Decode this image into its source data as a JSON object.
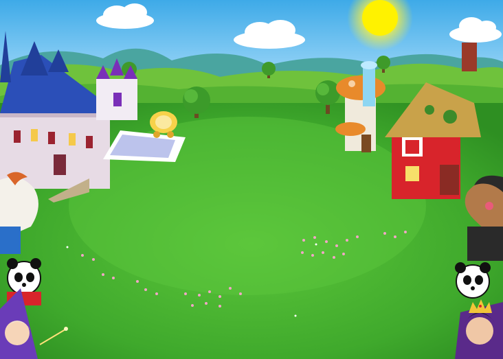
{
  "scene": {
    "colors": {
      "sky_top": "#4fb6f0",
      "sky_bottom": "#bfe8ff",
      "sun": "#fff23a",
      "meadow": "#3da42b",
      "meadow_light": "#58c23a",
      "hills_far": "#4aa5a0",
      "hills_mid": "#6cc03a",
      "castle_roof": "#2b4fb8",
      "castle_wall": "#e7dbe5",
      "palace_roof": "#7a2fb8",
      "mushroom_cap": "#e88a2b",
      "barn_red": "#d8242b",
      "thatch": "#c9a24a"
    },
    "icons": [
      "sun-icon",
      "cloud-icon",
      "castle-icon",
      "palace-icon",
      "carriage-icon",
      "mushroom-house-icon",
      "waterfall-icon",
      "cottage-icon",
      "tree-icon",
      "flower-icon",
      "horse-icon",
      "panda-icon",
      "fairy-godmother-icon",
      "pony-icon",
      "queen-icon"
    ],
    "flower_patch_count": 8
  }
}
